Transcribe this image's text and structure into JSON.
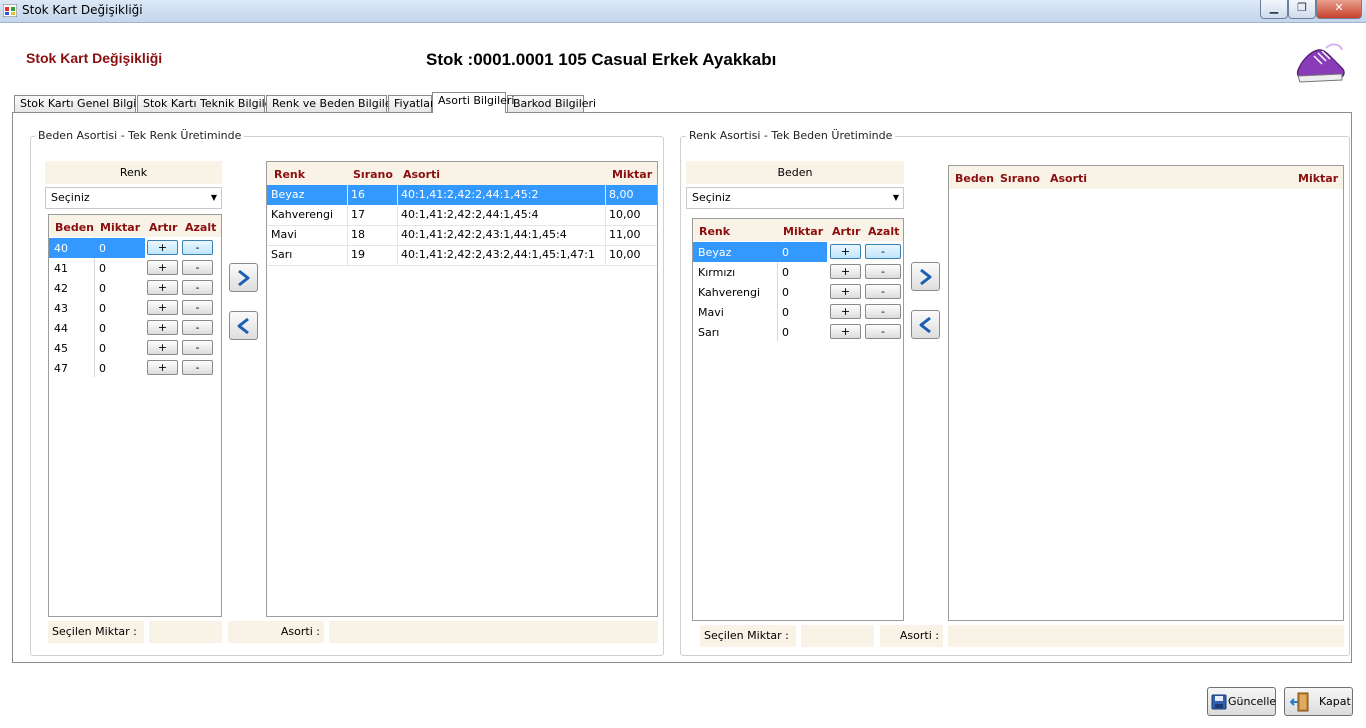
{
  "window": {
    "title": "Stok Kart Değişikliği",
    "controls": [
      "minimize",
      "maximize",
      "close"
    ]
  },
  "header": {
    "form_title": "Stok Kart Değişikliği",
    "stock_title": "Stok :0001.0001 105 Casual Erkek Ayakkabı",
    "logo_icon": "sneaker-icon"
  },
  "tabs": [
    {
      "label": "Stok Kartı Genel Bilgiler",
      "active": false
    },
    {
      "label": "Stok Kartı Teknik Bilgileri",
      "active": false
    },
    {
      "label": "Renk ve Beden Bilgileri",
      "active": false
    },
    {
      "label": "Fiyatlar",
      "active": false
    },
    {
      "label": "Asorti Bilgileri",
      "active": true
    },
    {
      "label": "Barkod Bilgileri",
      "active": false
    }
  ],
  "left_group": {
    "title": "Beden Asortisi - Tek Renk Üretiminde",
    "filter_label": "Renk",
    "filter_value": "Seçiniz",
    "size_grid": {
      "headers": [
        "Beden",
        "Miktar",
        "Artır",
        "Azalt"
      ],
      "rows": [
        {
          "beden": "40",
          "miktar": "0"
        },
        {
          "beden": "41",
          "miktar": "0"
        },
        {
          "beden": "42",
          "miktar": "0"
        },
        {
          "beden": "43",
          "miktar": "0"
        },
        {
          "beden": "44",
          "miktar": "0"
        },
        {
          "beden": "45",
          "miktar": "0"
        },
        {
          "beden": "47",
          "miktar": "0"
        }
      ],
      "selected_row": 0,
      "plus": "+",
      "minus": "-"
    },
    "assort_grid": {
      "headers": [
        "Renk",
        "Sırano",
        "Asorti",
        "Miktar"
      ],
      "rows": [
        {
          "renk": "Beyaz",
          "sirano": "16",
          "asorti": "40:1,41:2,42:2,44:1,45:2",
          "miktar": "8,00"
        },
        {
          "renk": "Kahverengi",
          "sirano": "17",
          "asorti": "40:1,41:2,42:2,44:1,45:4",
          "miktar": "10,00"
        },
        {
          "renk": "Mavi",
          "sirano": "18",
          "asorti": "40:1,41:2,42:2,43:1,44:1,45:4",
          "miktar": "11,00"
        },
        {
          "renk": "Sarı",
          "sirano": "19",
          "asorti": "40:1,41:2,42:2,43:2,44:1,45:1,47:1",
          "miktar": "10,00"
        }
      ],
      "selected_row": 0
    },
    "selected_qty_label": "Seçilen Miktar :",
    "selected_qty_value": "",
    "asorti_label": "Asorti :",
    "asorti_value": ""
  },
  "right_group": {
    "title": "Renk Asortisi - Tek Beden Üretiminde",
    "filter_label": "Beden",
    "filter_value": "Seçiniz",
    "color_grid": {
      "headers": [
        "Renk",
        "Miktar",
        "Artır",
        "Azalt"
      ],
      "rows": [
        {
          "renk": "Beyaz",
          "miktar": "0"
        },
        {
          "renk": "Kırmızı",
          "miktar": "0"
        },
        {
          "renk": "Kahverengi",
          "miktar": "0"
        },
        {
          "renk": "Mavi",
          "miktar": "0"
        },
        {
          "renk": "Sarı",
          "miktar": "0"
        }
      ],
      "selected_row": 0,
      "plus": "+",
      "minus": "-"
    },
    "assort_grid": {
      "headers": [
        "Beden",
        "Sırano",
        "Asorti",
        "Miktar"
      ],
      "rows": []
    },
    "selected_qty_label": "Seçilen Miktar :",
    "selected_qty_value": "",
    "asorti_label": "Asorti :",
    "asorti_value": ""
  },
  "buttons": {
    "update": "Güncelle",
    "close": "Kapat"
  },
  "colors": {
    "header_red": "#8b0f0f",
    "selection_blue": "#3399ff",
    "panel_beige": "#f8f3e6"
  }
}
